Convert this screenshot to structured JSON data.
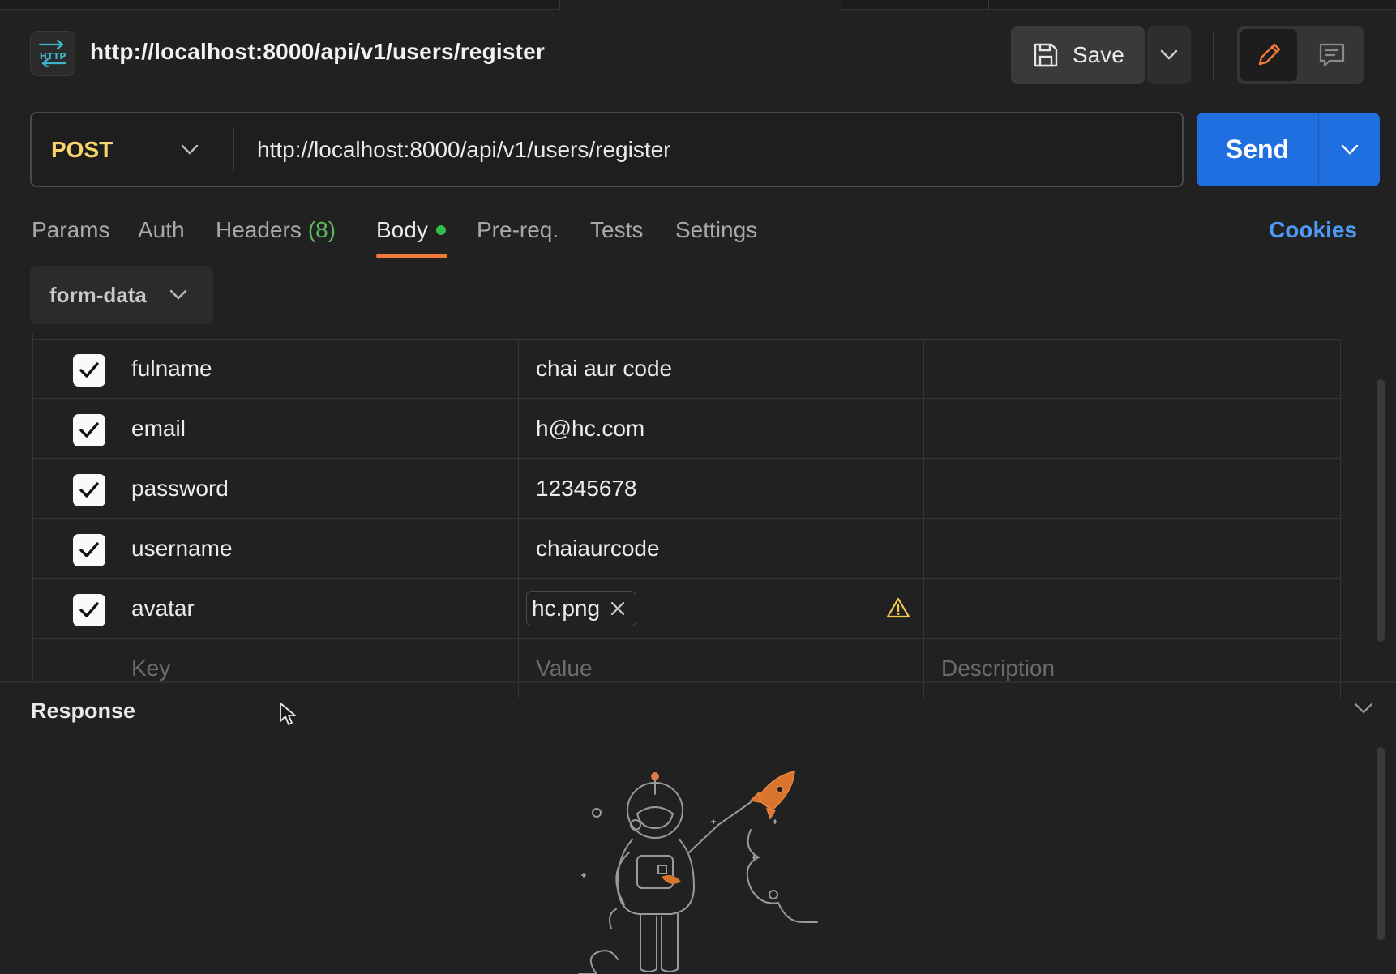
{
  "request": {
    "title": "http://localhost:8000/api/v1/users/register",
    "method": "POST",
    "url": "http://localhost:8000/api/v1/users/register"
  },
  "header": {
    "http_badge": "HTTP",
    "save_label": "Save"
  },
  "send": {
    "label": "Send"
  },
  "tabs": [
    {
      "label": "Params"
    },
    {
      "label": "Auth"
    },
    {
      "label": "Headers",
      "count": "(8)"
    },
    {
      "label": "Body",
      "active": true
    },
    {
      "label": "Pre-req."
    },
    {
      "label": "Tests"
    },
    {
      "label": "Settings"
    }
  ],
  "cookies_label": "Cookies",
  "body_type": "form-data",
  "form_rows": [
    {
      "checked": true,
      "key": "fulname",
      "value": "chai aur code",
      "description": ""
    },
    {
      "checked": true,
      "key": "email",
      "value": "h@hc.com",
      "description": ""
    },
    {
      "checked": true,
      "key": "password",
      "value": "12345678",
      "description": ""
    },
    {
      "checked": true,
      "key": "username",
      "value": "chaiaurcode",
      "description": ""
    },
    {
      "checked": true,
      "key": "avatar",
      "value": "hc.png",
      "type": "file",
      "description": ""
    }
  ],
  "form_placeholders": {
    "key": "Key",
    "value": "Value",
    "description": "Description"
  },
  "response": {
    "title": "Response"
  },
  "colors": {
    "accent_blue": "#1f6fe0",
    "method_yellow": "#f7d36b",
    "active_tab_underline": "#f07a3a",
    "cookies_link": "#4d9af7",
    "body_dot": "#2fbf4a"
  },
  "icons": [
    "http-icon",
    "save-icon",
    "chevron-down-icon",
    "pencil-icon",
    "comment-icon",
    "check-icon",
    "close-icon",
    "warning-icon",
    "astronaut-illustration"
  ]
}
